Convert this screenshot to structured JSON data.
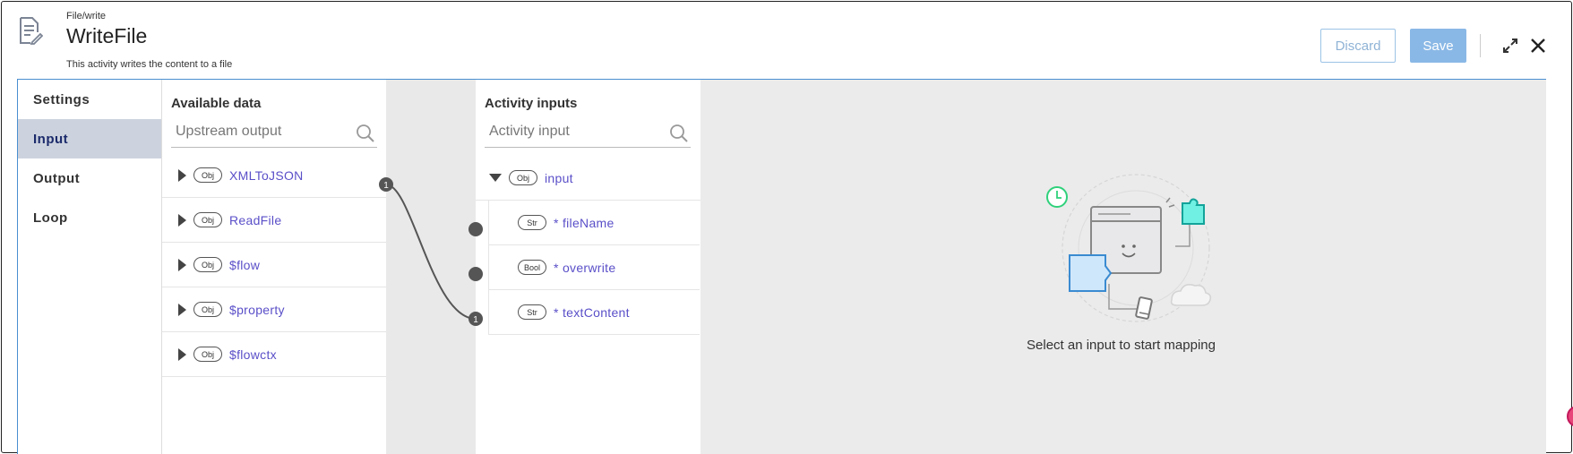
{
  "header": {
    "category": "File/write",
    "title": "WriteFile",
    "description": "This activity writes the content to a file",
    "discard_label": "Discard",
    "save_label": "Save"
  },
  "tabs": [
    {
      "label": "Settings",
      "active": false
    },
    {
      "label": "Input",
      "active": true
    },
    {
      "label": "Output",
      "active": false
    },
    {
      "label": "Loop",
      "active": false
    }
  ],
  "available_data": {
    "title": "Available data",
    "search_placeholder": "Upstream output",
    "items": [
      {
        "type": "Obj",
        "label": "XMLToJSON",
        "mapped_count": "1"
      },
      {
        "type": "Obj",
        "label": "ReadFile"
      },
      {
        "type": "Obj",
        "label": "$flow"
      },
      {
        "type": "Obj",
        "label": "$property"
      },
      {
        "type": "Obj",
        "label": "$flowctx"
      }
    ]
  },
  "activity_inputs": {
    "title": "Activity inputs",
    "search_placeholder": "Activity input",
    "root": {
      "type": "Obj",
      "label": "input"
    },
    "items": [
      {
        "type": "Str",
        "label": "* fileName"
      },
      {
        "type": "Bool",
        "label": "* overwrite"
      },
      {
        "type": "Str",
        "label": "* textContent",
        "mapped_count": "1"
      }
    ]
  },
  "preview": {
    "caption": "Select an input to start mapping"
  },
  "colors": {
    "accent": "#4a8fd1",
    "link": "#5a4fc8",
    "active_tab_bg": "#cdd3de",
    "save_bg": "#8ab8e6"
  }
}
